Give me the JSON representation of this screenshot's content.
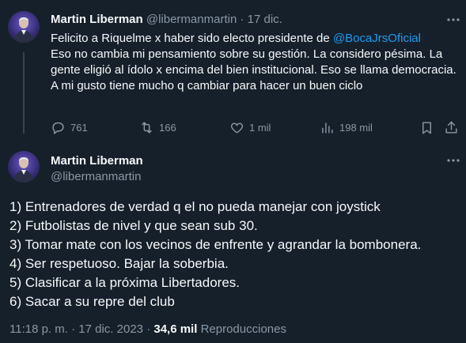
{
  "tweet1": {
    "author_name": "Martin Liberman",
    "handle": "@libermanmartin",
    "separator": "·",
    "date": "17 dic.",
    "body_prefix": "Felicito a Riquelme x haber sido electo presidente de ",
    "mention": "@BocaJrsOficial",
    "lines": [
      "Eso no cambia mi pensamiento sobre su gestión. La considero pésima. La gente eligió al ídolo x encima del bien institucional. Eso se llama democracia.",
      "A mi gusto tiene mucho q cambiar para hacer un buen ciclo"
    ],
    "replies": "761",
    "retweets": "166",
    "likes": "1 mil",
    "views": "198 mil"
  },
  "tweet2": {
    "author_name": "Martin Liberman",
    "handle": "@libermanmartin",
    "lines": [
      "1) Entrenadores de verdad q el no pueda manejar con joystick",
      "2) Futbolistas de nivel y que sean sub 30.",
      "3) Tomar mate con los vecinos de enfrente y agrandar la bombonera.",
      "4) Ser respetuoso. Bajar la soberbia.",
      "5) Clasificar a la próxima Libertadores.",
      "6) Sacar a su repre del club"
    ],
    "time": "11:18 p. m.",
    "separator": "·",
    "date": "17 dic. 2023",
    "views_count": "34,6 mil",
    "views_label": "Reproducciones"
  },
  "colors": {
    "background": "#15202b",
    "text": "#f7f9f9",
    "secondary": "#8b98a5",
    "accent": "#1d9bf0"
  },
  "icons": [
    "reply-icon",
    "retweet-icon",
    "like-icon",
    "views-icon",
    "bookmark-icon",
    "share-icon",
    "more-icon"
  ]
}
